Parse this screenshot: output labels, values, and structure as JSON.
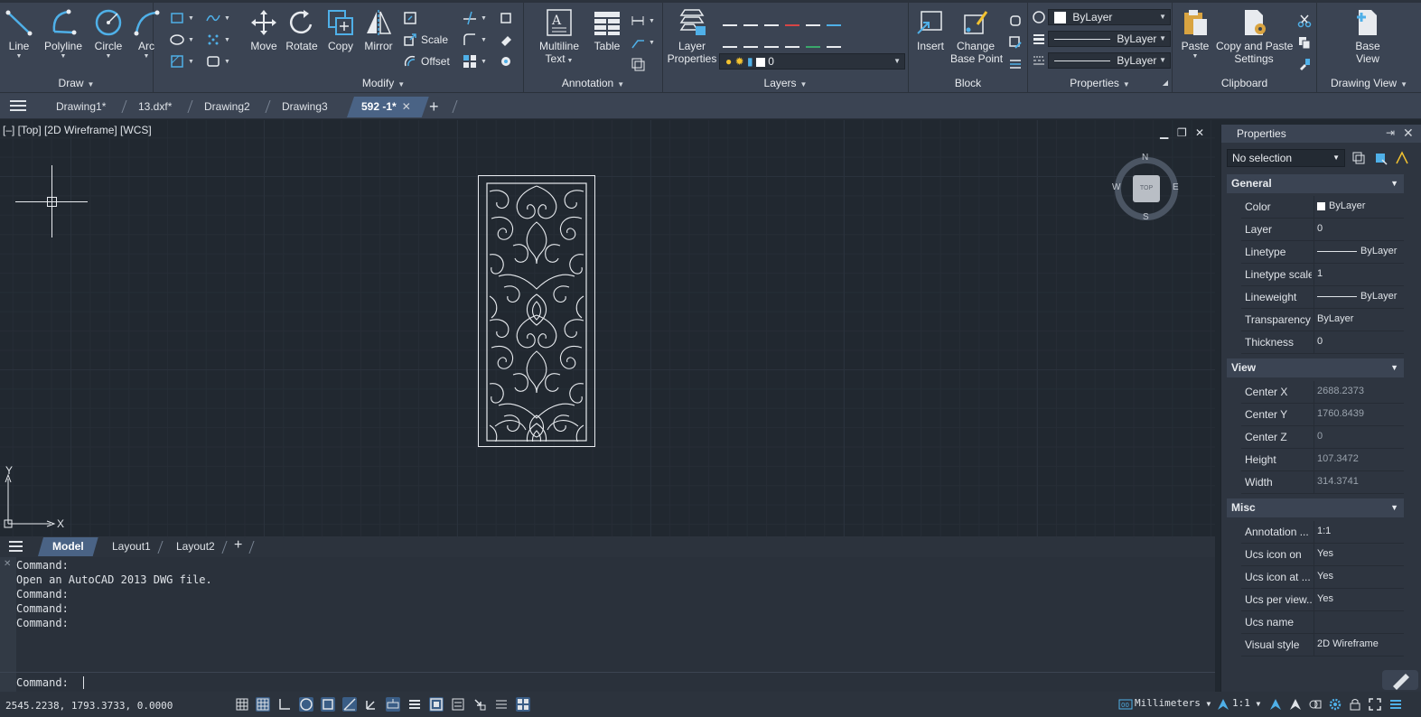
{
  "ribbon": {
    "draw": {
      "title": "Draw",
      "line": "Line",
      "polyline": "Polyline",
      "circle": "Circle",
      "arc": "Arc"
    },
    "modify": {
      "title": "Modify",
      "move": "Move",
      "rotate": "Rotate",
      "copy": "Copy",
      "mirror": "Mirror",
      "scale": "Scale",
      "offset": "Offset"
    },
    "annotation": {
      "title": "Annotation",
      "mtext_1": "Multiline",
      "mtext_2": "Text",
      "table": "Table"
    },
    "layers": {
      "title": "Layers",
      "props_1": "Layer",
      "props_2": "Properties",
      "current_layer": "0"
    },
    "block": {
      "title": "Block",
      "insert": "Insert",
      "change_1": "Change",
      "change_2": "Base Point"
    },
    "properties": {
      "title": "Properties",
      "color": "ByLayer",
      "linetype": "ByLayer",
      "lineweight": "ByLayer"
    },
    "clipboard": {
      "title": "Clipboard",
      "paste": "Paste",
      "copy_paste_1": "Copy and Paste",
      "copy_paste_2": "Settings"
    },
    "drawing_view": {
      "title": "Drawing View",
      "base_1": "Base",
      "base_2": "View"
    }
  },
  "tabs": [
    {
      "label": "Drawing1*"
    },
    {
      "label": "13.dxf*"
    },
    {
      "label": "Drawing2"
    },
    {
      "label": "Drawing3"
    },
    {
      "label": "592 -1*"
    }
  ],
  "viewport": {
    "label": "[–] [Top] [2D Wireframe] [WCS]",
    "compass": {
      "n": "N",
      "s": "S",
      "e": "E",
      "w": "W",
      "cube": "TOP"
    },
    "ucs": {
      "x": "X",
      "y": "Y"
    }
  },
  "layout_tabs": [
    {
      "label": "Model"
    },
    {
      "label": "Layout1"
    },
    {
      "label": "Layout2"
    }
  ],
  "command": {
    "history": [
      "Command:",
      "Open an AutoCAD 2013 DWG file.",
      "Command:",
      "Command:",
      "Command:"
    ],
    "prompt": "Command:"
  },
  "status": {
    "coords": "2545.2238, 1793.3733, 0.0000",
    "units": "Millimeters",
    "scale": "1:1"
  },
  "properties_panel": {
    "title": "Properties",
    "selection": "No selection",
    "general": {
      "title": "General",
      "rows": [
        {
          "k": "Color",
          "v": "ByLayer"
        },
        {
          "k": "Layer",
          "v": "0"
        },
        {
          "k": "Linetype",
          "v": "ByLayer"
        },
        {
          "k": "Linetype scale",
          "v": "1"
        },
        {
          "k": "Lineweight",
          "v": "ByLayer"
        },
        {
          "k": "Transparency",
          "v": "ByLayer"
        },
        {
          "k": "Thickness",
          "v": "0"
        }
      ]
    },
    "view": {
      "title": "View",
      "rows": [
        {
          "k": "Center X",
          "v": "2688.2373"
        },
        {
          "k": "Center Y",
          "v": "1760.8439"
        },
        {
          "k": "Center Z",
          "v": "0"
        },
        {
          "k": "Height",
          "v": "107.3472"
        },
        {
          "k": "Width",
          "v": "314.3741"
        }
      ]
    },
    "misc": {
      "title": "Misc",
      "rows": [
        {
          "k": "Annotation ...",
          "v": "1:1"
        },
        {
          "k": "Ucs icon on",
          "v": "Yes"
        },
        {
          "k": "Ucs icon at ...",
          "v": "Yes"
        },
        {
          "k": "Ucs per view...",
          "v": "Yes"
        },
        {
          "k": "Ucs name",
          "v": ""
        },
        {
          "k": "Visual style",
          "v": "2D Wireframe"
        }
      ]
    }
  },
  "colors": {
    "ribbon_bg": "#3b4453",
    "canvas_bg": "#212830",
    "accent": "#4a6385",
    "icon_blue": "#4fb0e8"
  }
}
